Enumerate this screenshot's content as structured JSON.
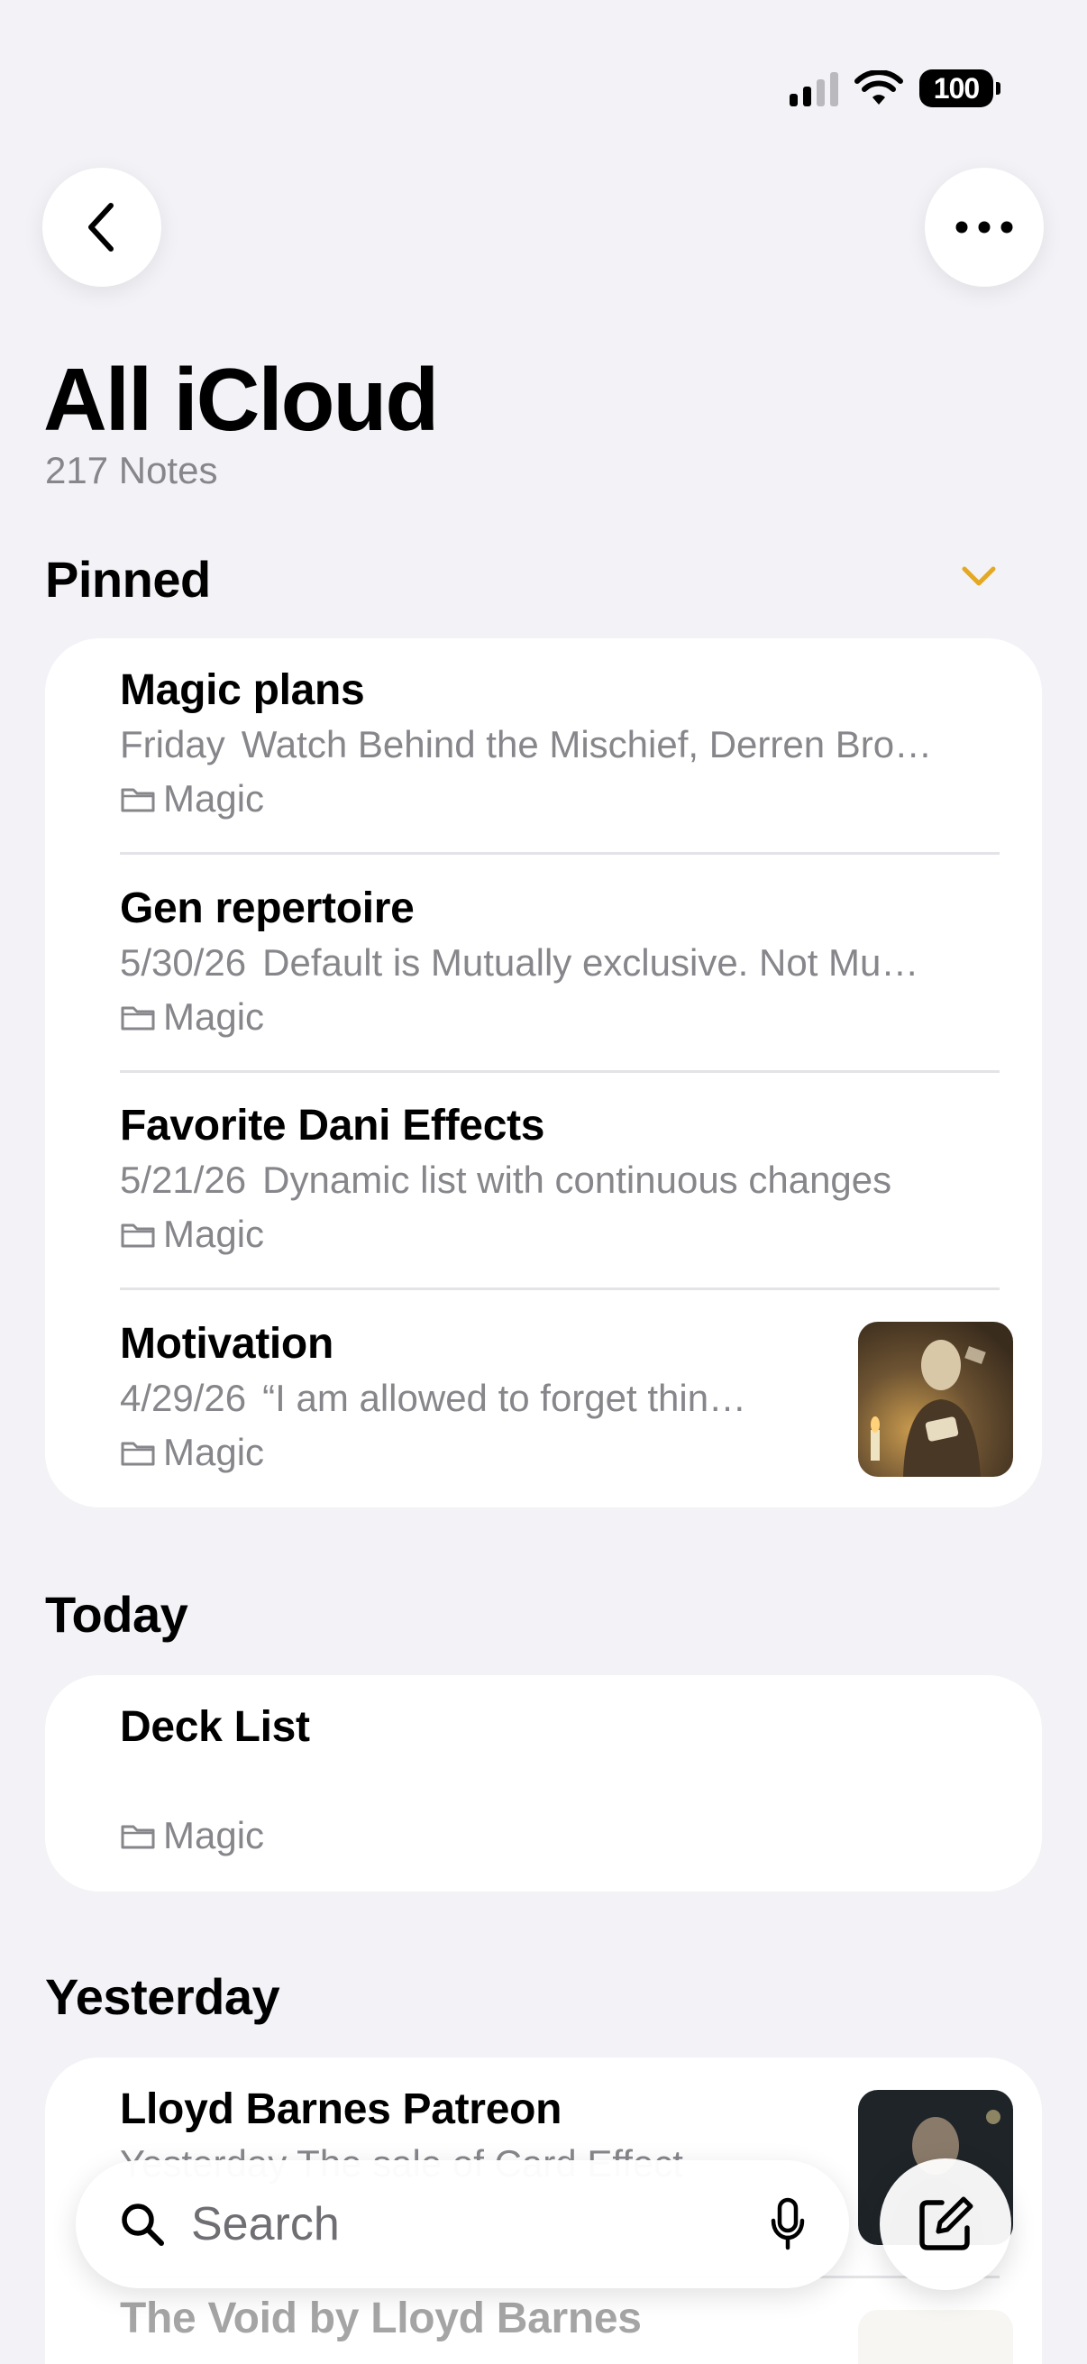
{
  "status": {
    "battery": "100"
  },
  "header": {
    "title": "All iCloud",
    "count": "217 Notes"
  },
  "pinned": {
    "label": "Pinned",
    "notes": [
      {
        "title": "Magic plans",
        "date": "Friday",
        "preview": "Watch Behind the Mischief, Derren Bro…",
        "folder": "Magic"
      },
      {
        "title": "Gen repertoire",
        "date": "5/30/26",
        "preview": "Default is Mutually exclusive. Not Mu…",
        "folder": "Magic"
      },
      {
        "title": "Favorite Dani Effects",
        "date": "5/21/26",
        "preview": "Dynamic list with continuous changes",
        "folder": "Magic"
      },
      {
        "title": "Motivation",
        "date": "4/29/26",
        "preview": "“I am allowed to forget thin…",
        "folder": "Magic"
      }
    ]
  },
  "today": {
    "label": "Today",
    "notes": [
      {
        "title": "Deck List",
        "folder": "Magic"
      }
    ]
  },
  "yesterday": {
    "label": "Yesterday",
    "notes": [
      {
        "title": "Lloyd Barnes Patreon",
        "preview": "Yesterday  The sale of Card Effect"
      },
      {
        "title": "The Void by Lloyd Barnes"
      }
    ]
  },
  "search": {
    "placeholder": "Search"
  },
  "icons": [
    "back-chevron-icon",
    "more-icon",
    "chevron-down-icon",
    "folder-icon",
    "search-icon",
    "microphone-icon",
    "compose-icon"
  ],
  "colors": {
    "accent": "#e5a823",
    "background": "#f2f2f7",
    "secondary_text": "#86868b"
  }
}
